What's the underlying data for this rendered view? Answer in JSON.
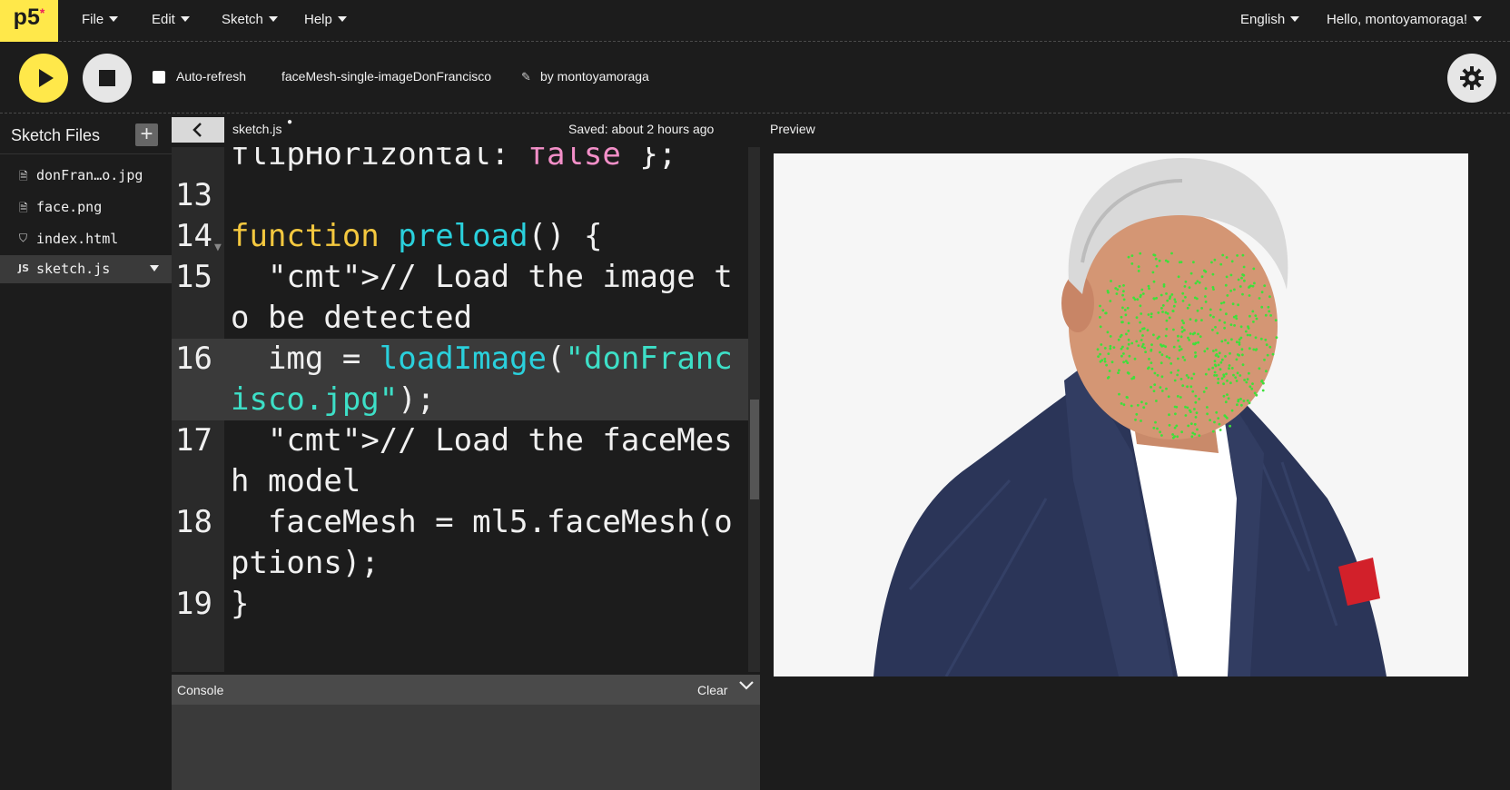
{
  "nav": {
    "logo": "p5",
    "logo_mark": "*",
    "menus": [
      "File",
      "Edit",
      "Sketch",
      "Help"
    ],
    "language": "English",
    "greeting": "Hello, montoyamoraga!"
  },
  "toolbar": {
    "auto_refresh_label": "Auto-refresh",
    "auto_refresh_checked": false,
    "sketch_name": "faceMesh-single-imageDonFrancisco",
    "byline": "by montoyamoraga"
  },
  "sidebar": {
    "title": "Sketch Files",
    "add_label": "+",
    "files": [
      {
        "name": "donFran…o.jpg",
        "icon": "file-icon",
        "glyph": "🗎"
      },
      {
        "name": "face.png",
        "icon": "file-icon",
        "glyph": "🗎"
      },
      {
        "name": "index.html",
        "icon": "html-file-icon",
        "glyph": "⛉"
      },
      {
        "name": "sketch.js",
        "icon": "js-file-icon",
        "glyph": "JS",
        "active": true
      }
    ]
  },
  "editor": {
    "tab_name": "sketch.js",
    "unsaved_mark": "●",
    "saved_status": "Saved: about 2 hours ago",
    "lines": [
      {
        "n": "",
        "text": "flipHorizontal: false };"
      },
      {
        "n": "13",
        "text": ""
      },
      {
        "n": "14",
        "text": "function preload() {"
      },
      {
        "n": "15",
        "text": "  // Load the image to be detected"
      },
      {
        "n": "16",
        "text": "  img = loadImage(\"donFrancisco.jpg\");"
      },
      {
        "n": "17",
        "text": "  // Load the faceMesh model"
      },
      {
        "n": "18",
        "text": "  faceMesh = ml5.faceMesh(options);"
      },
      {
        "n": "19",
        "text": "}"
      }
    ]
  },
  "console": {
    "title": "Console",
    "clear_label": "Clear"
  },
  "preview": {
    "label": "Preview"
  },
  "colors": {
    "accent": "#ffe84a",
    "background": "#1c1c1c",
    "mesh": "#3ee03a",
    "suit": "#2b3558"
  }
}
